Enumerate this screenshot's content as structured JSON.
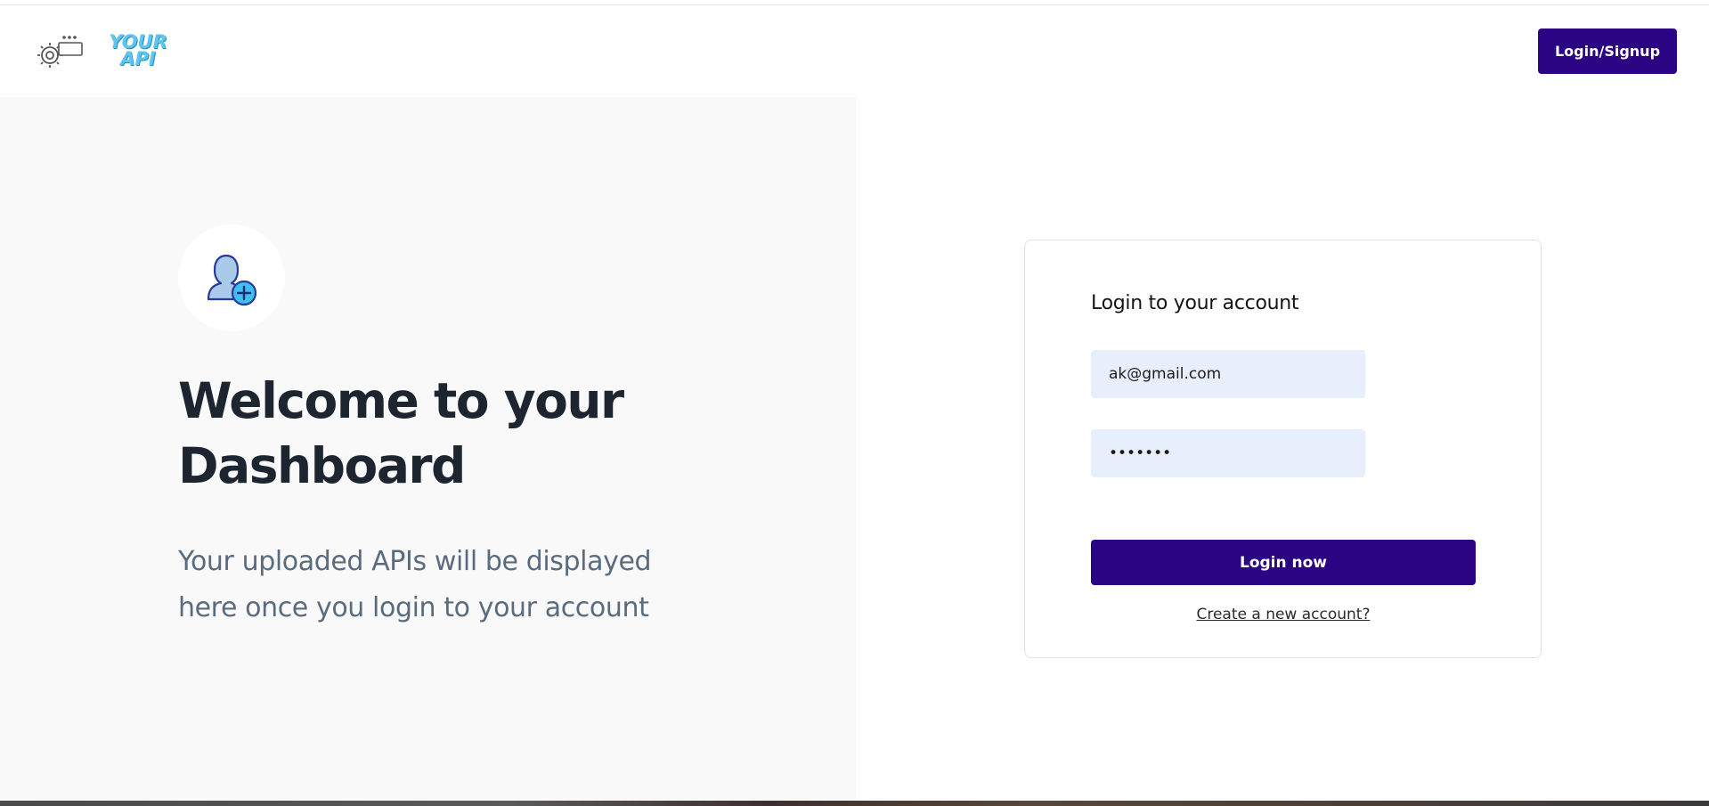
{
  "header": {
    "logo_text_line1": "YOUR",
    "logo_text_line2": "API",
    "login_signup_label": "Login/Signup"
  },
  "welcome": {
    "title_line1": "Welcome to your",
    "title_line2": "Dashboard",
    "subtitle_line1": "Your uploaded APIs will be displayed",
    "subtitle_line2": "here once you login to your account"
  },
  "login": {
    "title": "Login to your account",
    "email_value": "ak@gmail.com",
    "password_value": "•••••••",
    "submit_label": "Login now",
    "create_account_label": "Create a new account?"
  },
  "colors": {
    "brand_primary": "#2a0482",
    "input_background": "#e8effc",
    "panel_background": "#f9f9f9",
    "logo_blue": "#5ec6ee"
  },
  "icons": {
    "logo": "gear-api-logo-icon",
    "avatar": "add-user-icon"
  }
}
